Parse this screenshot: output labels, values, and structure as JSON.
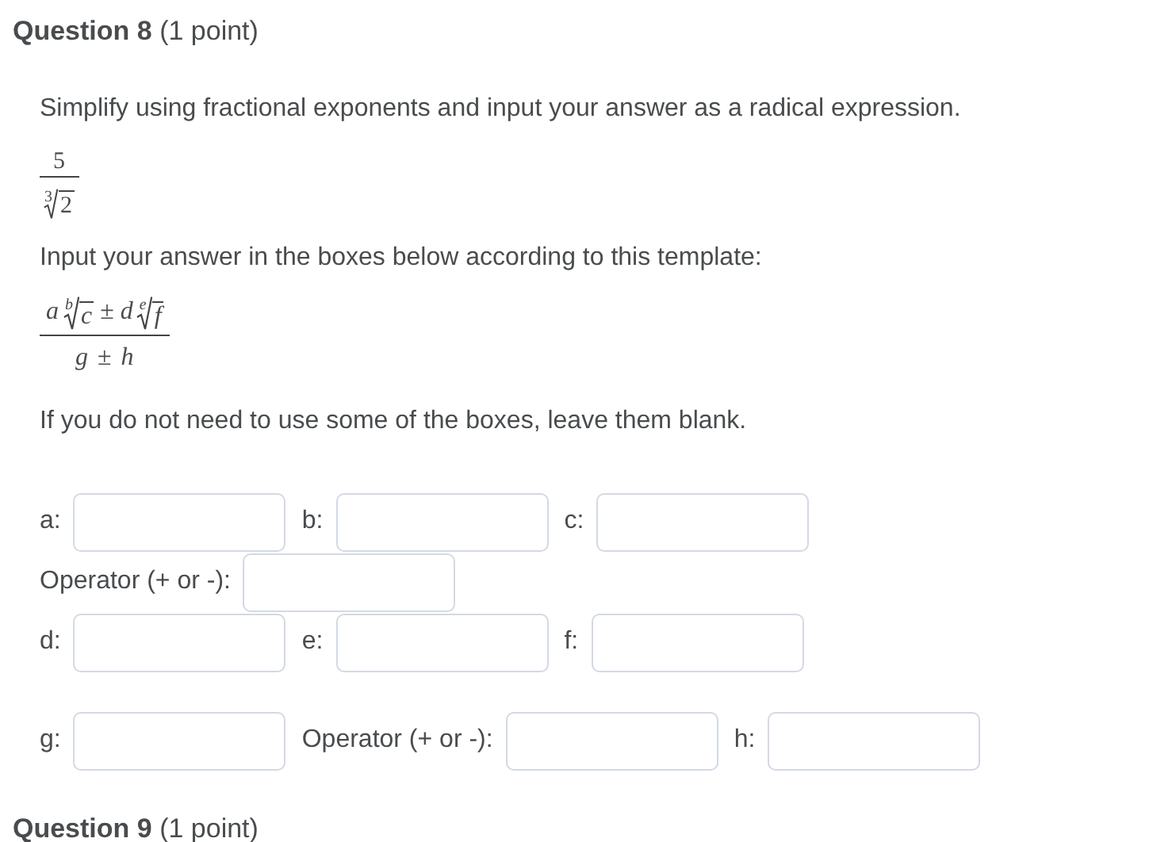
{
  "title": "**Question 8** (1 point)",
  "instruction": "Simplify using fractional exponents and input your answer as a radical expression.",
  "expression": {
    "numerator": "5",
    "denominator": {
      "index": "3",
      "radicand": "2"
    }
  },
  "template_intro": "Input your answer in the boxes below according to this template:",
  "template": {
    "numerator": [
      {
        "kind": "var",
        "text": "a"
      },
      {
        "kind": "root",
        "index": "b",
        "radicand": "c"
      },
      {
        "kind": "op",
        "text": "±"
      },
      {
        "kind": "var",
        "text": "d"
      },
      {
        "kind": "root",
        "index": "e",
        "radicand": "f"
      }
    ],
    "denominator": [
      {
        "kind": "var",
        "text": "g"
      },
      {
        "kind": "op",
        "text": "±"
      },
      {
        "kind": "var",
        "text": "h"
      }
    ]
  },
  "note": "If you do not need to use some of the boxes, leave them blank.",
  "rows": [
    {
      "fields": [
        {
          "label": "a:"
        },
        {
          "label": "b:"
        },
        {
          "label": "c:"
        }
      ]
    },
    {
      "fields": [
        {
          "label": "Operator (+ or -):"
        }
      ]
    },
    {
      "fields": [
        {
          "label": "d:"
        },
        {
          "label": "e:"
        },
        {
          "label": "f:"
        }
      ]
    },
    {
      "fields": [
        {
          "label": "g:"
        },
        {
          "label": "Operator (+ or -):"
        },
        {
          "label": "h:"
        }
      ]
    }
  ],
  "next_title": "**Question 9** (1 point)"
}
